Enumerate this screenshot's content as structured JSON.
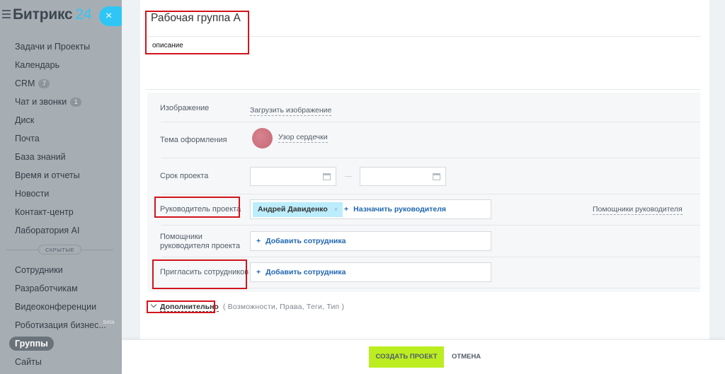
{
  "sidebar": {
    "logo_text": "Битрикс",
    "logo_number": "24",
    "close_glyph": "×",
    "items": [
      {
        "label": "Задачи и Проекты"
      },
      {
        "label": "Календарь"
      },
      {
        "label": "CRM",
        "counter": "7"
      },
      {
        "label": "Чат и звонки",
        "counter": "1"
      },
      {
        "label": "Диск"
      },
      {
        "label": "Почта"
      },
      {
        "label": "База знаний"
      },
      {
        "label": "Время и отчеты"
      },
      {
        "label": "Новости"
      },
      {
        "label": "Контакт-центр"
      },
      {
        "label": "Лаборатория AI"
      }
    ],
    "hidden_label": "СКРЫТЫЕ",
    "hidden_items": [
      {
        "label": "Сотрудники"
      },
      {
        "label": "Разработчикам"
      },
      {
        "label": "Видеоконференции"
      },
      {
        "label": "Роботизация бизнес...",
        "badge": "beta"
      },
      {
        "label": "Группы"
      },
      {
        "label": "Сайты"
      }
    ]
  },
  "form": {
    "group_name": "Рабочая группа А",
    "description": "описание",
    "image_label": "Изображение",
    "image_link": "Загрузить изображение",
    "theme_label": "Тема оформления",
    "theme_value": "Узор сердечки",
    "deadline_label": "Срок проекта",
    "owner_label": "Руководитель проекта",
    "owner_tag": "Андрей Давиденко",
    "owner_tag_remove": "×",
    "owner_add": "Назначить руководителя",
    "deputies_link": "Помощники руководителя",
    "deputies_label_1": "Помощники",
    "deputies_label_2": "руководителя проекта",
    "deputies_add": "Добавить сотрудника",
    "invite_label": "Пригласить сотрудников",
    "invite_add": "Добавить сотрудника",
    "plus_glyph": "+",
    "more_label": "Дополнительно",
    "more_details": "( Возможности,  Права,  Теги,  Тип  )"
  },
  "footer": {
    "create_label": "СОЗДАТЬ ПРОЕКТ",
    "cancel_label": "ОТМЕНА"
  },
  "colors": {
    "sidebar_bg": "#a7aeb3",
    "accent_blue": "#2fc6f6",
    "create_button": "#bbed21",
    "annotation_red": "#d2141c",
    "link_blue": "#2067b0"
  }
}
